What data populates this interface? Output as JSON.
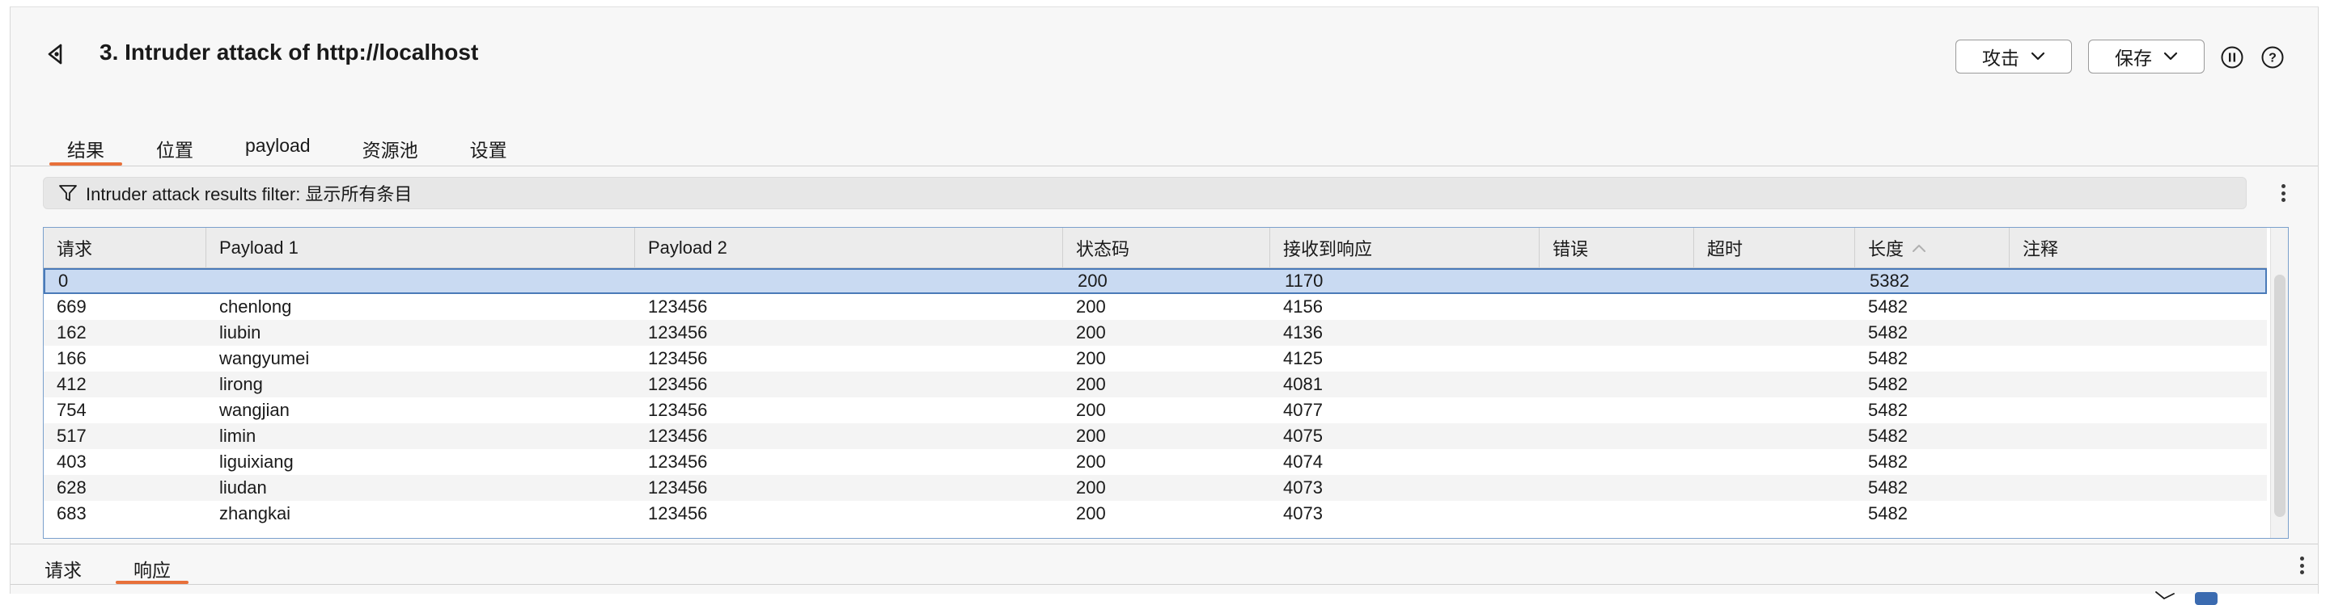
{
  "header": {
    "title": "3. Intruder attack of http://localhost",
    "attack_label": "攻击",
    "save_label": "保存",
    "icons": [
      "back-icon",
      "pause-icon",
      "help-icon",
      "chevron-down-icon"
    ]
  },
  "tabs": [
    {
      "label": "结果",
      "active": true
    },
    {
      "label": "位置",
      "active": false
    },
    {
      "label": "payload",
      "active": false
    },
    {
      "label": "资源池",
      "active": false
    },
    {
      "label": "设置",
      "active": false
    }
  ],
  "filter": {
    "text": "Intruder attack results filter: 显示所有条目",
    "icon": "filter-icon"
  },
  "table": {
    "columns": [
      "请求",
      "Payload 1",
      "Payload 2",
      "状态码",
      "接收到响应",
      "错误",
      "超时",
      "长度",
      "注释"
    ],
    "sorted_column": "长度",
    "sort_direction": "ascending",
    "rows": [
      [
        "0",
        "",
        "",
        "200",
        "1170",
        "",
        "",
        "5382",
        ""
      ],
      [
        "669",
        "chenlong",
        "123456",
        "200",
        "4156",
        "",
        "",
        "5482",
        ""
      ],
      [
        "162",
        "liubin",
        "123456",
        "200",
        "4136",
        "",
        "",
        "5482",
        ""
      ],
      [
        "166",
        "wangyumei",
        "123456",
        "200",
        "4125",
        "",
        "",
        "5482",
        ""
      ],
      [
        "412",
        "lirong",
        "123456",
        "200",
        "4081",
        "",
        "",
        "5482",
        ""
      ],
      [
        "754",
        "wangjian",
        "123456",
        "200",
        "4077",
        "",
        "",
        "5482",
        ""
      ],
      [
        "517",
        "limin",
        "123456",
        "200",
        "4075",
        "",
        "",
        "5482",
        ""
      ],
      [
        "403",
        "liguixiang",
        "123456",
        "200",
        "4074",
        "",
        "",
        "5482",
        ""
      ],
      [
        "628",
        "liudan",
        "123456",
        "200",
        "4073",
        "",
        "",
        "5482",
        ""
      ],
      [
        "683",
        "zhangkai",
        "123456",
        "200",
        "4073",
        "",
        "",
        "5482",
        ""
      ]
    ],
    "selected_row": 0
  },
  "bottom_tabs": [
    {
      "label": "请求",
      "active": false
    },
    {
      "label": "响应",
      "active": true
    }
  ],
  "colors": {
    "accent": "#e8703a",
    "selection": "#c9daf2",
    "selection_border": "#4a7ab8"
  }
}
